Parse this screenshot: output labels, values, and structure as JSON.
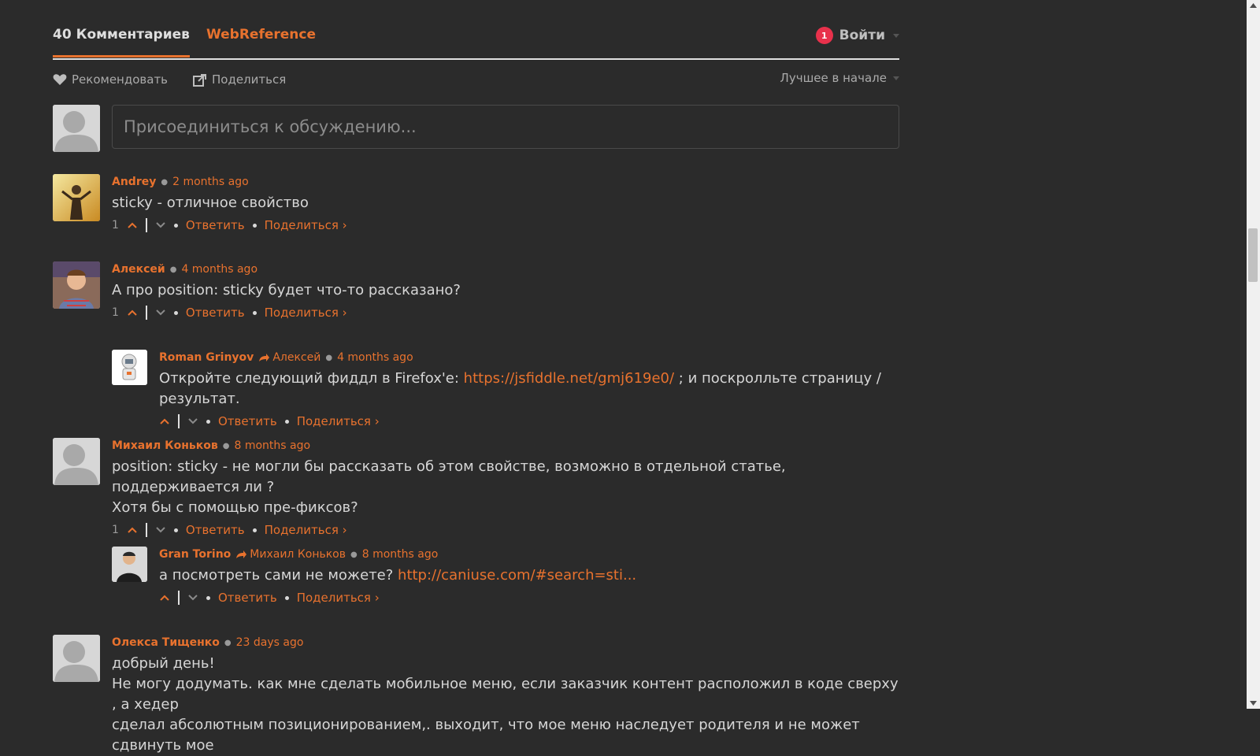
{
  "header": {
    "comment_count": "40 Комментариев",
    "site_tab": "WebReference",
    "notification_count": "1",
    "login_label": "Войти"
  },
  "actions": {
    "recommend": "Рекомендовать",
    "share": "Поделиться",
    "sort": "Лучшее в начале"
  },
  "compose": {
    "placeholder": "Присоединиться к обсуждению..."
  },
  "labels": {
    "reply": "Ответить",
    "share": "Поделиться ›"
  },
  "comments": [
    {
      "author": "Andrey",
      "time": "2 months ago",
      "text": "sticky - отличное свойство",
      "votes": "1"
    },
    {
      "author": "Алексей",
      "time": "4 months ago",
      "text": "А про position: sticky будет что-то рассказано?",
      "votes": "1"
    },
    {
      "author": "Roman Grinyov",
      "reply_to": "Алексей",
      "time": "4 months ago",
      "text_before": "Откройте следующий фиддл в Firefox'е: ",
      "link": "https://jsfiddle.net/gmj619e0/",
      "text_after": " ; и поскролльте страницу / результат.",
      "votes": ""
    },
    {
      "author": "Михаил Коньков",
      "time": "8 months ago",
      "text_line1": "position: sticky - не могли бы рассказать об этом свойстве, возможно в отдельной статье, поддерживается ли ?",
      "text_line2": "Хотя бы с помощью пре-фиксов?",
      "votes": "1"
    },
    {
      "author": "Gran Torino",
      "reply_to": "Михаил Коньков",
      "time": "8 months ago",
      "text_before": "а посмотреть сами не можете? ",
      "link": "http://caniuse.com/#search=sti...",
      "votes": ""
    },
    {
      "author": "Олекса Тищенко",
      "time": "23 days ago",
      "text_line1": "добрый день!",
      "text_line2": "Не могу додумать. как мне сделать мобильное меню, если заказчик контент расположил в коде сверху , а хедер",
      "text_line3": "сделал абсолютным позиционированием,. выходит, что мое меню наследует родителя и не может сдвинуть мое"
    }
  ],
  "colors": {
    "background": "#2b2b2b",
    "accent": "#e8722e",
    "badge": "#e8314b",
    "text": "#d6d6d6"
  }
}
